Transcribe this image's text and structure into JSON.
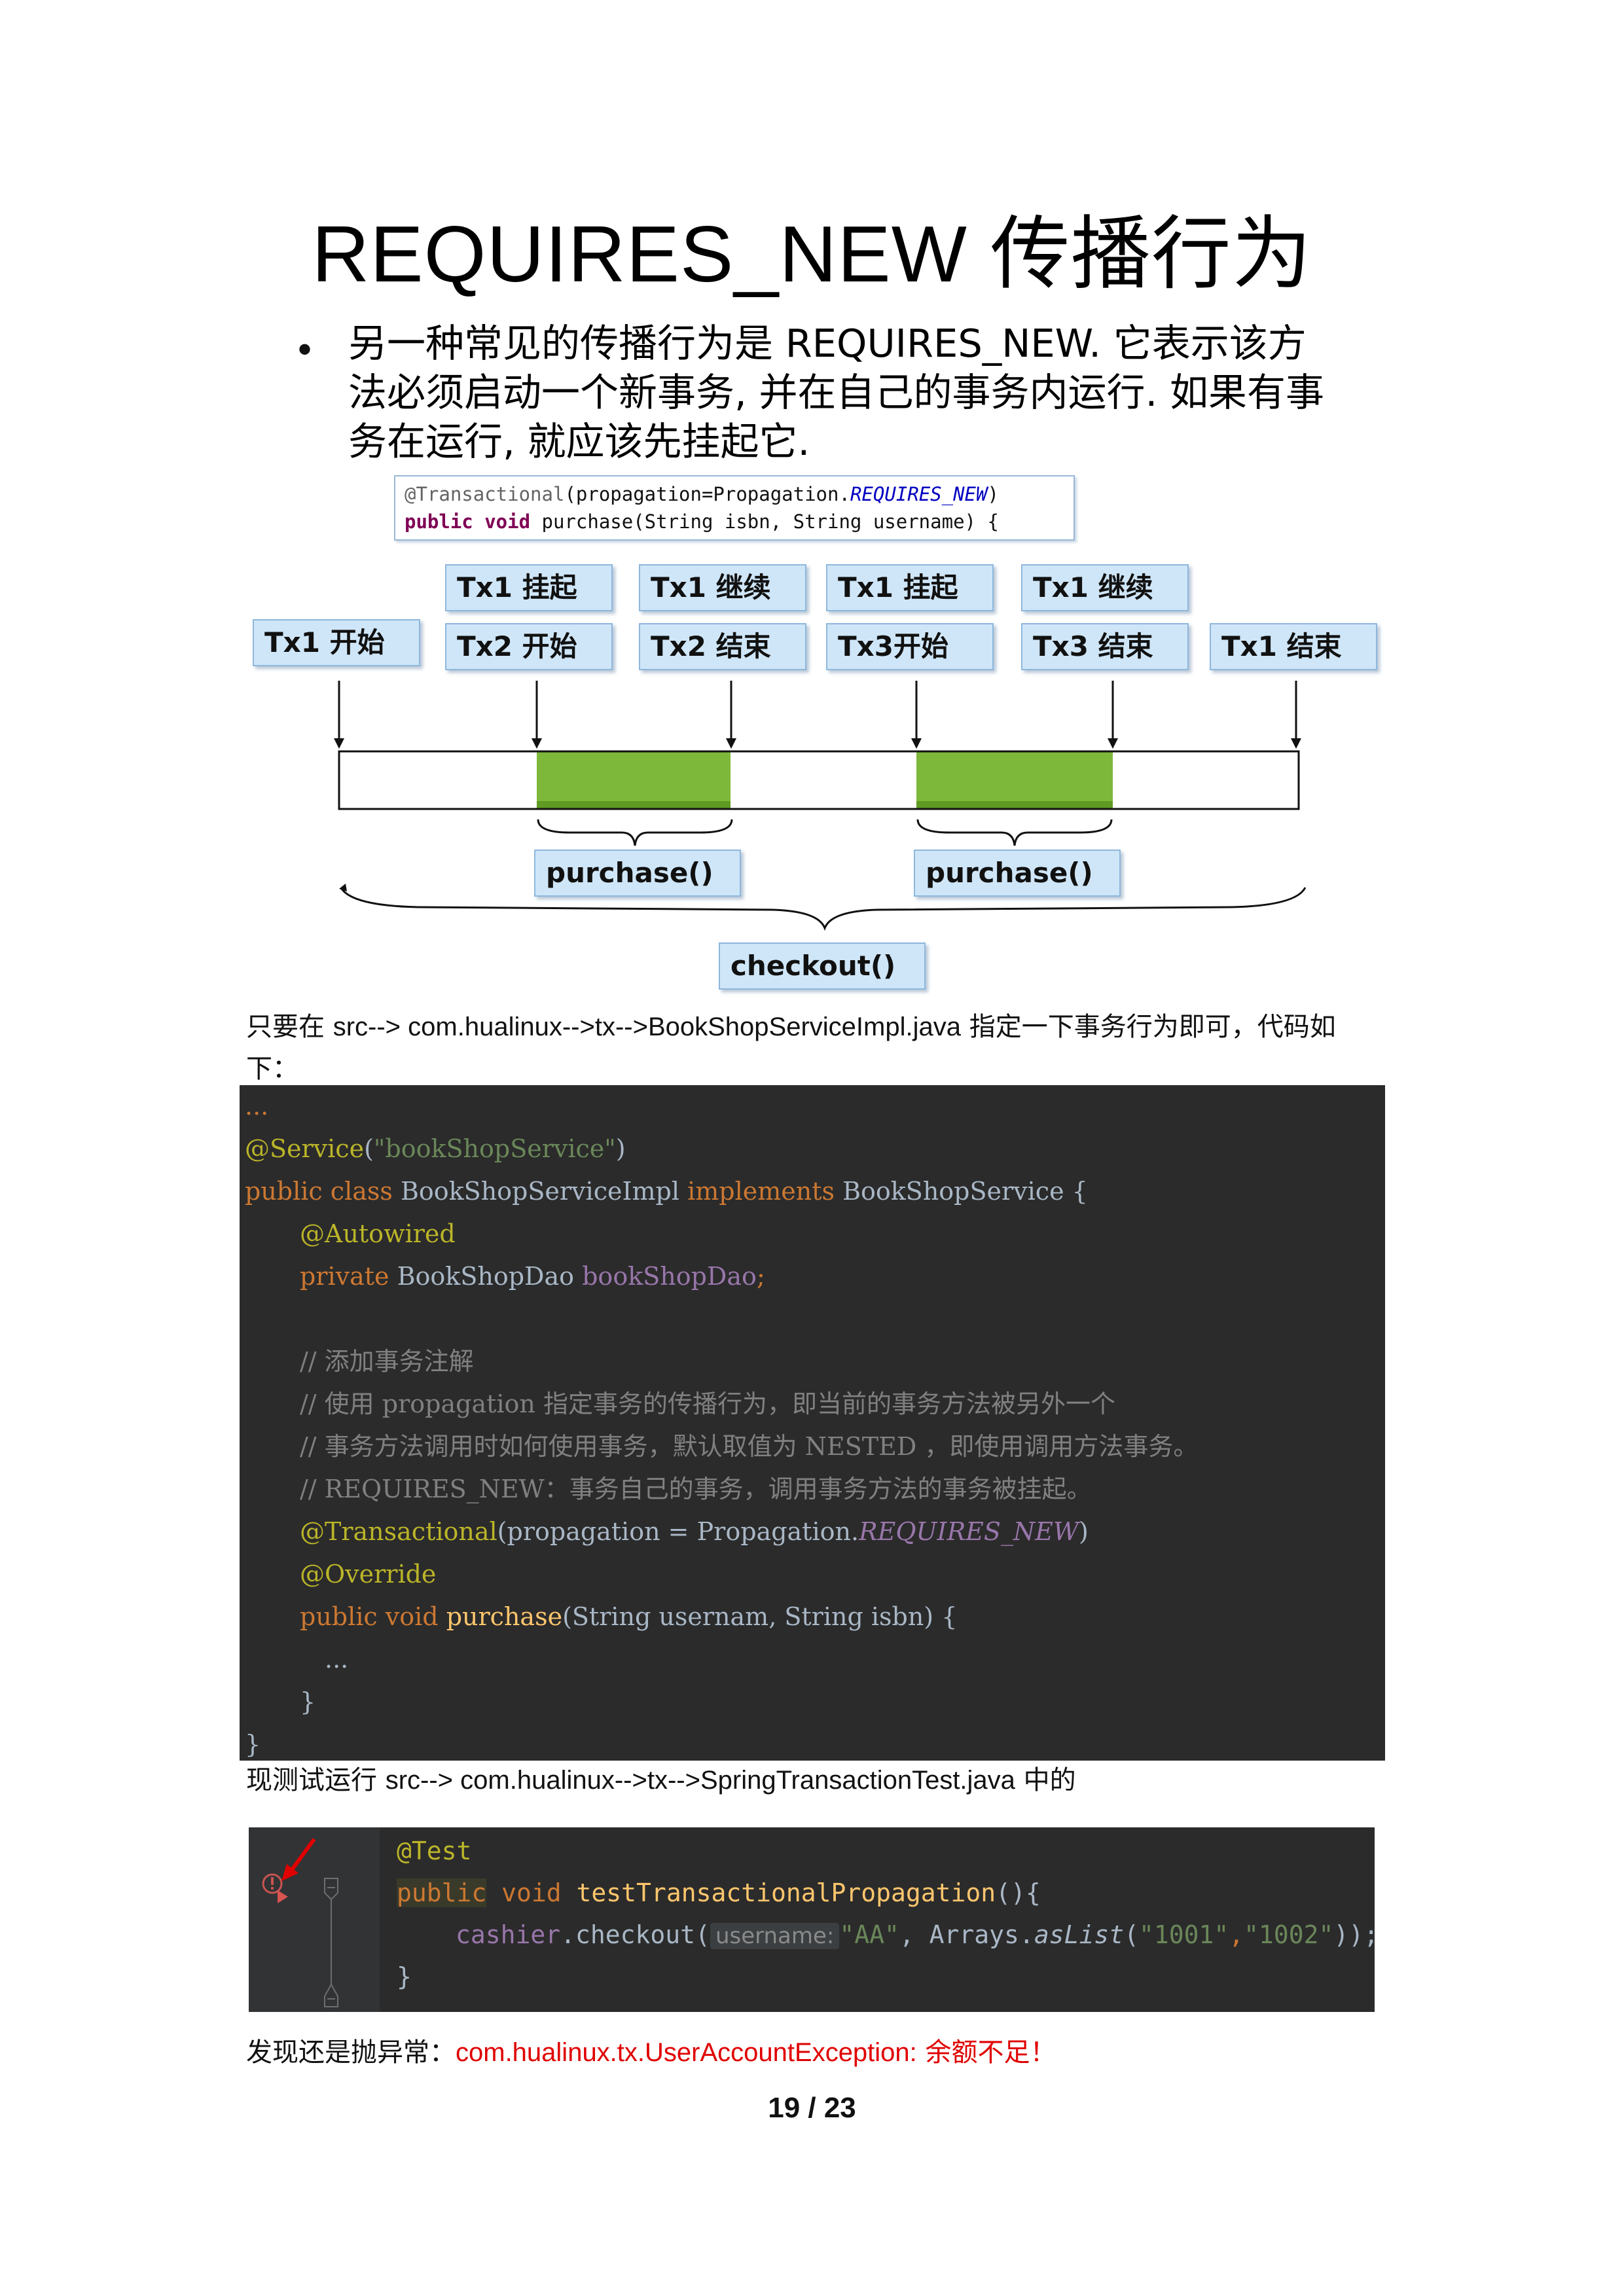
{
  "slide": {
    "title": "REQUIRES_NEW 传播行为",
    "bullet_symbol": "•",
    "bullet_lines": [
      "另一种常见的传播行为是 REQUIRES_NEW. 它表示该方",
      "法必须启动一个新事务, 并在自己的事务内运行. 如果有事",
      "务在运行, 就应该先挂起它."
    ],
    "annotation": {
      "line1_annot": "@Transactional",
      "line1_mid": "(propagation=Propagation.",
      "line1_const": "REQUIRES_NEW",
      "line1_end": ")",
      "line2_kw": "public void",
      "line2_rest": " purchase(String isbn, String username) {"
    }
  },
  "diagram": {
    "labels_top": [
      "Tx1 挂起",
      "Tx1 继续",
      "Tx1 挂起",
      "Tx1 继续"
    ],
    "labels_bottom": [
      "Tx1 开始",
      "Tx2 开始",
      "Tx2 结束",
      "Tx3开始",
      "Tx3 结束",
      "Tx1 结束"
    ],
    "purchase_label": "purchase()",
    "checkout_label": "checkout()",
    "colors": {
      "box_fill": "#cfe6f8",
      "box_border": "#8eb7dd",
      "active_fill": "#7db83a"
    }
  },
  "captions": {
    "intro_a": "只要在 ",
    "intro_b": "src--> com.hualinux-->tx-->BookShopServiceImpl.java",
    "intro_c": " 指定一下事务行为即可，代码如",
    "intro_d": "下：",
    "run_a": "现测试运行 ",
    "run_b": "src--> com.hualinux-->tx-->SpringTransactionTest.java",
    "run_c": " 中的",
    "result_a": "发现还是抛异常：",
    "result_b": "com.hualinux.tx.UserAccountException:",
    "result_c": "  余额不足！"
  },
  "code1": {
    "l1": "...",
    "l2_ann": "@Service",
    "l2_p1": "(",
    "l2_str": "\"bookShopService\"",
    "l2_p2": ")",
    "l3_kw": "public class",
    "l3_name": " BookShopServiceImpl ",
    "l3_impl": "implements",
    "l3_iface": " BookShopService {",
    "l4_ann": "@Autowired",
    "l5_kw": "private",
    "l5_type": " BookShopDao ",
    "l5_field": "bookShopDao",
    "l5_semi": ";",
    "c1": "// 添加事务注解",
    "c2": "// 使用 propagation 指定事务的传播行为，即当前的事务方法被另外一个",
    "c3": "// 事务方法调用时如何使用事务，默认取值为 NESTED ，即使用调用方法事务。",
    "c4": "// REQUIRES_NEW：事务自己的事务，调用事务方法的事务被挂起。",
    "l10_ann": "@Transactional",
    "l10_mid": "(propagation = Propagation.",
    "l10_const": "REQUIRES_NEW",
    "l10_end": ")",
    "l11_ann": "@Override",
    "l12_kw": "public void",
    "l12_fn": " purchase",
    "l12_rest": "(String usernam, String isbn) {",
    "l13": "...",
    "l14": "}",
    "l15": "}"
  },
  "code2": {
    "l1_ann": "@Test",
    "l2_kw1": "public",
    "l2_kw2": " void",
    "l2_fn": " testTransactionalPropagation",
    "l2_end": "(){",
    "l3_obj": "cashier",
    "l3_call": ".checkout(",
    "l3_hint": "username:",
    "l3_str1": "\"AA\"",
    "l3_comma": ", Arrays.",
    "l3_static": "asList",
    "l3_open": "(",
    "l3_str2": "\"1001\"",
    "l3_c2": ",",
    "l3_str3": "\"1002\"",
    "l3_close": "));",
    "l4": "}"
  },
  "page": {
    "number": "19 / 23"
  }
}
